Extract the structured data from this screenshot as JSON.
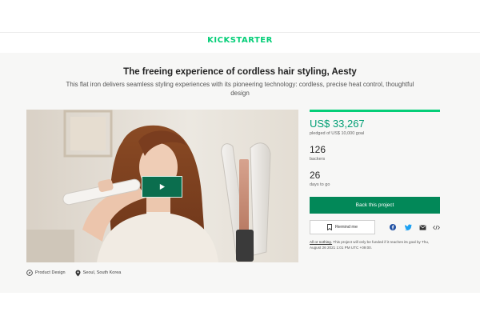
{
  "brand": {
    "logo": "KICKSTARTER",
    "accent": "#05ce78"
  },
  "project": {
    "title": "The freeing experience of cordless hair styling, Aesty",
    "blurb": "This flat iron delivers seamless styling experiences with its pioneering technology: cordless, precise heat control, thoughtful design"
  },
  "video": {
    "play_icon": "play-icon"
  },
  "meta": {
    "category": "Product Design",
    "category_icon": "compass-icon",
    "location": "Seoul, South Korea",
    "location_icon": "location-pin-icon"
  },
  "stats": {
    "progress_fraction": 1.0,
    "pledged": "US$ 33,267",
    "goal_text": "pledged of US$ 10,000 goal",
    "backers_count": "126",
    "backers_label": "backers",
    "days_count": "26",
    "days_label": "days to go"
  },
  "actions": {
    "back_label": "Back this project",
    "back_color": "#028858",
    "remind_label": "Remind me",
    "remind_icon": "bookmark-icon",
    "share_icons": [
      "facebook-icon",
      "twitter-icon",
      "email-icon",
      "embed-icon"
    ]
  },
  "funding_note": {
    "link": "All or nothing.",
    "text": " This project will only be funded if it reaches its goal by Thu, August 26 2021 1:01 PM UTC +09:00."
  }
}
